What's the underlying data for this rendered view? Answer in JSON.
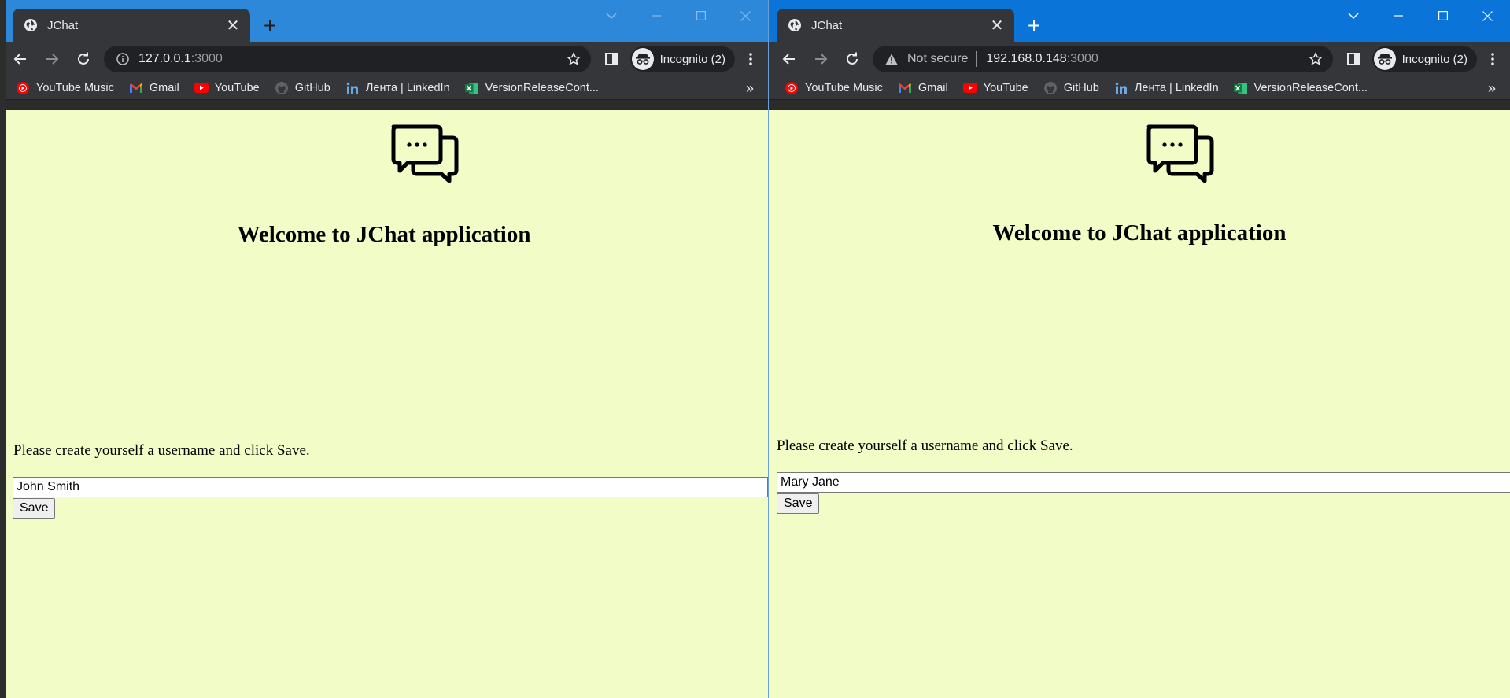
{
  "colors": {
    "page_background": "#f2fcc7",
    "titlebar_left": "#2e88d9",
    "titlebar_right": "#0a74d8",
    "chrome_dark": "#35363a"
  },
  "windows": [
    {
      "tab": {
        "title": "JChat",
        "icon": "globe-icon"
      },
      "address": {
        "security_text": "",
        "host": "127.0.0.1",
        "port": ":3000",
        "icon": "info-icon"
      },
      "incognito_label": "Incognito (2)",
      "bookmarks": [
        {
          "label": "YouTube Music",
          "icon": "youtube-music-icon"
        },
        {
          "label": "Gmail",
          "icon": "gmail-icon"
        },
        {
          "label": "YouTube",
          "icon": "youtube-icon"
        },
        {
          "label": "GitHub",
          "icon": "github-icon"
        },
        {
          "label": "Лента | LinkedIn",
          "icon": "linkedin-icon"
        },
        {
          "label": "VersionReleaseCont...",
          "icon": "excel-icon"
        }
      ],
      "bookmarks_more": "»",
      "page": {
        "heading": "Welcome to JChat application",
        "prompt": "Please create yourself a username and click Save.",
        "username_value": "John Smith",
        "save_label": "Save"
      }
    },
    {
      "tab": {
        "title": "JChat",
        "icon": "globe-icon"
      },
      "address": {
        "security_text": "Not secure",
        "host": "192.168.0.148",
        "port": ":3000",
        "icon": "warning-icon"
      },
      "incognito_label": "Incognito (2)",
      "bookmarks": [
        {
          "label": "YouTube Music",
          "icon": "youtube-music-icon"
        },
        {
          "label": "Gmail",
          "icon": "gmail-icon"
        },
        {
          "label": "YouTube",
          "icon": "youtube-icon"
        },
        {
          "label": "GitHub",
          "icon": "github-icon"
        },
        {
          "label": "Лента | LinkedIn",
          "icon": "linkedin-icon"
        },
        {
          "label": "VersionReleaseCont...",
          "icon": "excel-icon"
        }
      ],
      "bookmarks_more": "»",
      "page": {
        "heading": "Welcome to JChat application",
        "prompt": "Please create yourself a username and click Save.",
        "username_value": "Mary Jane",
        "save_label": "Save"
      }
    }
  ]
}
